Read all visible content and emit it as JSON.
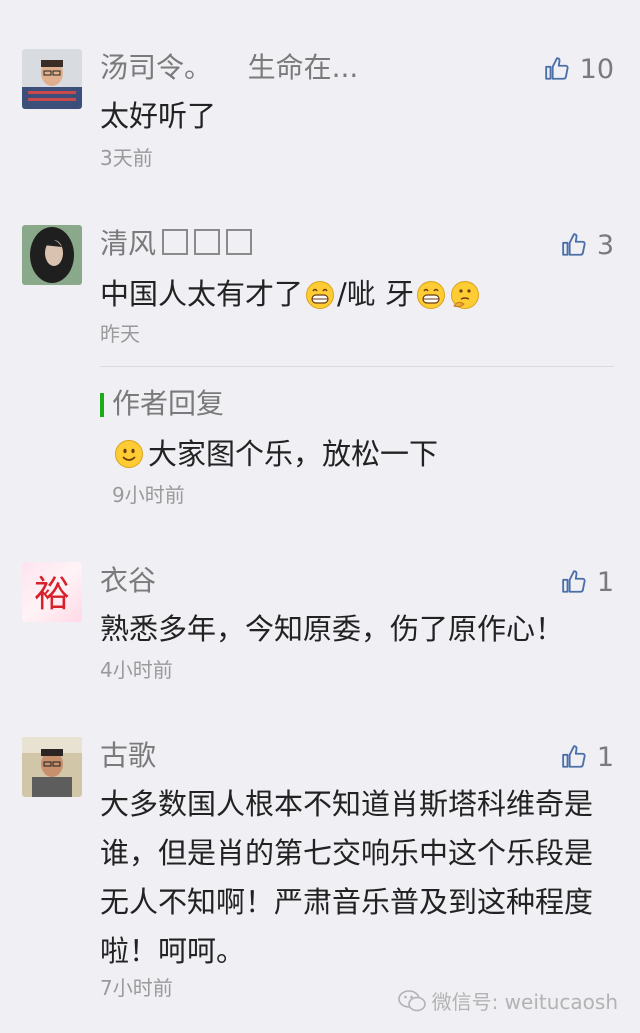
{
  "comments": [
    {
      "nickname": "汤司令。    生命在...",
      "likes": "10",
      "content": "太好听了",
      "time": "3天前"
    },
    {
      "nickname": "清风",
      "likes": "3",
      "content_a": "中国人太有才了",
      "content_b": "/呲 牙",
      "time": "昨天",
      "author_reply": {
        "label": "作者回复",
        "text": "大家图个乐，放松一下",
        "time": "9小时前"
      }
    },
    {
      "nickname": "衣谷",
      "likes": "1",
      "content": "熟悉多年，今知原委，伤了原作心！",
      "time": "4小时前"
    },
    {
      "nickname": "古歌",
      "likes": "1",
      "content": "大多数国人根本不知道肖斯塔科维奇是谁，但是肖的第七交响乐中这个乐段是无人不知啊！严肃音乐普及到这种程度啦！呵呵。",
      "time": "7小时前"
    }
  ],
  "avatar3_glyph": "裕",
  "watermark": "微信号: weitucaosh",
  "colors": {
    "background": "#efeff4",
    "accent_green": "#1aad19",
    "like_blue": "#4a6fa8"
  }
}
